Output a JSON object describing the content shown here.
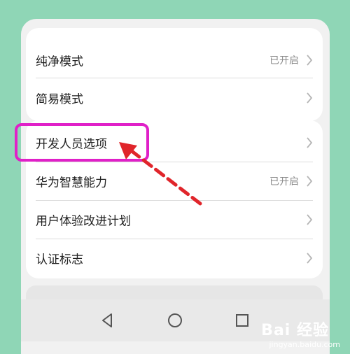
{
  "settings": {
    "group1": [
      {
        "label": "纯净模式",
        "value": "已开启"
      },
      {
        "label": "简易模式",
        "value": ""
      }
    ],
    "group2": [
      {
        "label": "开发人员选项",
        "value": ""
      },
      {
        "label": "华为智慧能力",
        "value": "已开启"
      },
      {
        "label": "用户体验改进计划",
        "value": ""
      },
      {
        "label": "认证标志",
        "value": ""
      }
    ]
  },
  "navbar": {
    "icons": [
      "back-triangle-icon",
      "home-circle-icon",
      "recents-square-icon"
    ]
  },
  "annotation": {
    "highlight_color": "#e020c8",
    "arrow_color": "#e0252b"
  },
  "watermark": {
    "logo": "Bai 经验",
    "url": "jingyan.baidu.com"
  }
}
